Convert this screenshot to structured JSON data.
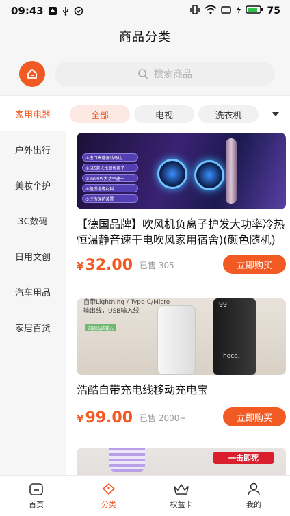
{
  "status_bar": {
    "time": "09:43",
    "battery": "75"
  },
  "header": {
    "title": "商品分类"
  },
  "search": {
    "placeholder": "搜索商品"
  },
  "sidebar": {
    "items": [
      {
        "label": "家用电器",
        "active": true
      },
      {
        "label": "户外出行",
        "active": false
      },
      {
        "label": "美妆个护",
        "active": false
      },
      {
        "label": "3C数码",
        "active": false
      },
      {
        "label": "日用文创",
        "active": false
      },
      {
        "label": "汽车用品",
        "active": false
      },
      {
        "label": "家居百货",
        "active": false
      }
    ]
  },
  "filters": {
    "chips": [
      {
        "label": "全部",
        "active": true
      },
      {
        "label": "电视",
        "active": false
      },
      {
        "label": "洗衣机",
        "active": false
      }
    ]
  },
  "products": [
    {
      "title": "【德国品牌】吹风机负离子护发大功率冷热恒温静音速干电吹风家用宿舍)(颜色随机)",
      "currency": "¥",
      "price": "32.00",
      "sold": "已售 305",
      "buy_label": "立即购买",
      "image_text": {
        "lines": [
          "①进口高速强劲马达",
          "②5亿蓝光水润负离子",
          "③2300W大功率速干",
          "④阻燃绝缘材料",
          "⑤过热保护装置"
        ]
      }
    },
    {
      "title": "浩酷自带充电线移动充电宝",
      "currency": "¥",
      "price": "99.00",
      "sold": "已售 2000+",
      "buy_label": "立即购买",
      "image_text": {
        "line1": "自带Lightning / Type-C/Micro",
        "line2": "输出线，USB输入线",
        "badge": "四输出/四输入",
        "brand": "hoco.",
        "display": "99"
      }
    },
    {
      "image_text": {
        "kill_badge": "一击即死"
      }
    }
  ],
  "tabbar": {
    "items": [
      {
        "label": "首页",
        "icon": "home-icon",
        "active": false
      },
      {
        "label": "分类",
        "icon": "category-icon",
        "active": true
      },
      {
        "label": "权益卡",
        "icon": "crown-icon",
        "active": false
      },
      {
        "label": "我的",
        "icon": "user-icon",
        "active": false
      }
    ]
  },
  "colors": {
    "accent": "#f25a23",
    "accent_light": "#fde9e3"
  }
}
